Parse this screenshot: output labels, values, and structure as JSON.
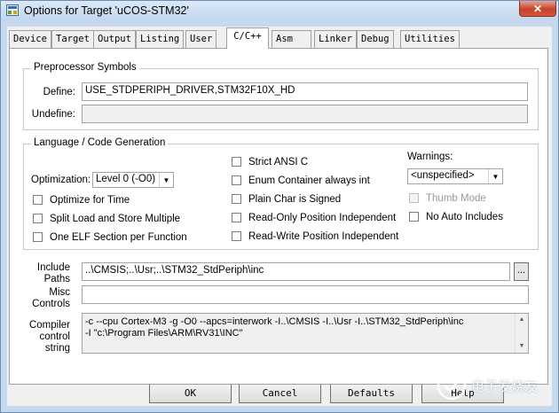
{
  "window": {
    "title": "Options for Target 'uCOS-STM32'",
    "close_label": "✕"
  },
  "tabs": [
    "Device",
    "Target",
    "Output",
    "Listing",
    "User",
    "C/C++",
    "Asm",
    "Linker",
    "Debug",
    "Utilities"
  ],
  "preprocessor": {
    "legend": "Preprocessor Symbols",
    "define_label": "Define:",
    "define_value": "USE_STDPERIPH_DRIVER,STM32F10X_HD",
    "undefine_label": "Undefine:",
    "undefine_value": ""
  },
  "codegen": {
    "legend": "Language / Code Generation",
    "optimization_label": "Optimization:",
    "optimization_value": "Level 0 (-O0)",
    "left_options": [
      {
        "label": "Optimize for Time",
        "checked": false
      },
      {
        "label": "Split Load and Store Multiple",
        "checked": false
      },
      {
        "label": "One ELF Section per Function",
        "checked": false
      }
    ],
    "middle_options": [
      {
        "label": "Strict ANSI C",
        "checked": false
      },
      {
        "label": "Enum Container always int",
        "checked": false
      },
      {
        "label": "Plain Char is Signed",
        "checked": false
      },
      {
        "label": "Read-Only Position Independent",
        "checked": false
      },
      {
        "label": "Read-Write Position Independent",
        "checked": false
      }
    ],
    "warnings_label": "Warnings:",
    "warnings_value": "<unspecified>",
    "thumb_mode_label": "Thumb Mode",
    "no_auto_includes_label": "No Auto Includes"
  },
  "include": {
    "label_line1": "Include",
    "label_line2": "Paths",
    "value": "..\\CMSIS;..\\Usr;..\\STM32_StdPeriph\\inc",
    "browse_label": "..."
  },
  "misc": {
    "label_line1": "Misc",
    "label_line2": "Controls",
    "value": ""
  },
  "compiler": {
    "label_line1": "Compiler",
    "label_line2": "control",
    "label_line3": "string",
    "line1": "-c --cpu Cortex-M3 -g -O0 --apcs=interwork -I..\\CMSIS -I..\\Usr -I..\\STM32_StdPeriph\\inc",
    "line2": "-I \"c:\\Program Files\\ARM\\RV31\\INC\""
  },
  "buttons": {
    "ok": "OK",
    "cancel": "Cancel",
    "defaults": "Defaults",
    "help": "Help"
  },
  "watermark": "电子发烧友",
  "colors": {
    "titlebar": "#c6d9ef",
    "close": "#c7442c",
    "panel": "#ffffff",
    "chrome": "#f0f0f0"
  }
}
